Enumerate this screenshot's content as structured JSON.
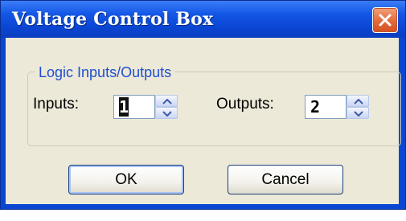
{
  "window": {
    "title": "Voltage Control Box",
    "close_icon": "close-icon"
  },
  "group": {
    "label": "Logic Inputs/Outputs"
  },
  "inputs": {
    "label": "Inputs:",
    "value": "1"
  },
  "outputs": {
    "label": "Outputs:",
    "value": "2"
  },
  "buttons": {
    "ok_label": "OK",
    "cancel_label": "Cancel"
  },
  "colors": {
    "titlebar": "#0a46d3",
    "client_bg": "#ece9d8",
    "group_label": "#1f4fcf",
    "close_button": "#e36a3b"
  }
}
